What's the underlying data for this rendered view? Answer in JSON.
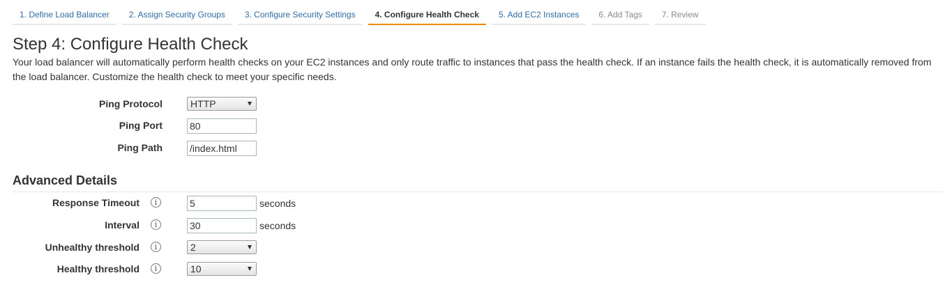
{
  "wizard": {
    "tabs": [
      {
        "label": "1. Define Load Balancer"
      },
      {
        "label": "2. Assign Security Groups"
      },
      {
        "label": "3. Configure Security Settings"
      },
      {
        "label": "4. Configure Health Check"
      },
      {
        "label": "5. Add EC2 Instances"
      },
      {
        "label": "6. Add Tags"
      },
      {
        "label": "7. Review"
      }
    ],
    "active_index": 3
  },
  "page": {
    "title": "Step 4: Configure Health Check",
    "description": "Your load balancer will automatically perform health checks on your EC2 instances and only route traffic to instances that pass the health check. If an instance fails the health check, it is automatically removed from the load balancer. Customize the health check to meet your specific needs."
  },
  "health_check": {
    "ping_protocol": {
      "label": "Ping Protocol",
      "value": "HTTP"
    },
    "ping_port": {
      "label": "Ping Port",
      "value": "80"
    },
    "ping_path": {
      "label": "Ping Path",
      "value": "/index.html"
    }
  },
  "advanced": {
    "heading": "Advanced Details",
    "info_glyph": "i",
    "response_timeout": {
      "label": "Response Timeout",
      "value": "5",
      "unit": "seconds"
    },
    "interval": {
      "label": "Interval",
      "value": "30",
      "unit": "seconds"
    },
    "unhealthy_threshold": {
      "label": "Unhealthy threshold",
      "value": "2"
    },
    "healthy_threshold": {
      "label": "Healthy threshold",
      "value": "10"
    }
  },
  "colors": {
    "link": "#2e6ba6",
    "active_tab_underline": "#e68a00",
    "inactive_tab": "#8a8a8a",
    "text": "#333333"
  }
}
